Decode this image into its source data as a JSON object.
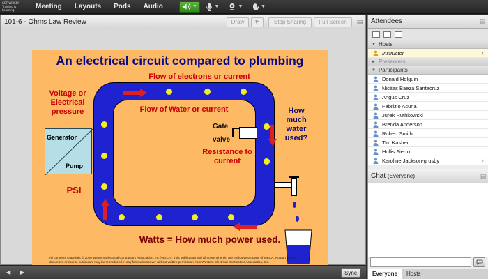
{
  "logo": {
    "line1": "GET WIRED!",
    "line2": "Training & Learning"
  },
  "menu": {
    "items": [
      "Meeting",
      "Layouts",
      "Pods",
      "Audio"
    ]
  },
  "toolbar": {
    "speaker_icon": "speaker-icon",
    "mic_icon": "microphone-icon",
    "camera_icon": "webcam-icon",
    "status_icon": "raise-hand-icon",
    "active_color": "#3c9a24"
  },
  "share_pod": {
    "title": "101-6 - Ohms Law Review",
    "draw_label": "Draw",
    "stop_sharing_label": "Stop Sharing",
    "full_screen_label": "Full Screen"
  },
  "slide": {
    "title": "An electrical circuit compared to plumbing",
    "flow_electrons": "Flow of electrons or current",
    "flow_water": "Flow of Water or current",
    "voltage_1": "Voltage  or",
    "voltage_2": "Electrical",
    "voltage_3": "pressure",
    "generator": "Generator",
    "pump": "Pump",
    "psi": "PSI",
    "gate": "Gate",
    "valve": "valve",
    "resistance_1": "Resistance to",
    "resistance_2": "current",
    "how_1": "How",
    "how_2": "much",
    "how_3": "water",
    "how_4": "used?",
    "watts": "Watts = How much power used.",
    "footer_1": "All contents Copyright © 2009 Western Electrical Contractors Association, Inc (WECA). This publication and all content herein are exclusive property of WECA. No part of this",
    "footer_2": "document or course curriculum may be reproduced in any form whatsoever without written permission from Western Electrical Contractors Association, Inc.",
    "pipe_color": "#1f22cf",
    "background": "#fdb964"
  },
  "bottombar": {
    "sync_label": "Sync"
  },
  "attendees": {
    "title": "Attendees",
    "hosts_label": "Hosts",
    "presenters_label": "Presenters",
    "participants_label": "Participants",
    "hosts": [
      {
        "name": "Instructor"
      }
    ],
    "participants": [
      {
        "name": "Donald Holguin"
      },
      {
        "name": "Nicéas Baeza Santacruz"
      },
      {
        "name": "Angus Cruz"
      },
      {
        "name": "Fabrizio Acuna"
      },
      {
        "name": "Jurek Ruthkowski"
      },
      {
        "name": "Brenda Anderson"
      },
      {
        "name": "Robert Smith"
      },
      {
        "name": "Tim Kasher"
      },
      {
        "name": "Hollis Fierro"
      },
      {
        "name": "Karoline Jackson-grusby"
      }
    ]
  },
  "chat": {
    "title": "Chat",
    "scope": "(Everyone)",
    "input_value": "",
    "tabs": [
      "Everyone",
      "Hosts"
    ]
  }
}
